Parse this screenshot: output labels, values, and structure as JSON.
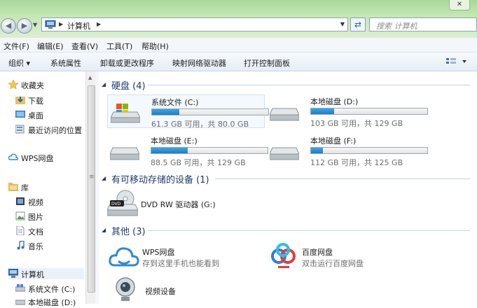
{
  "window": {
    "controls_label": "✕"
  },
  "address": {
    "breadcrumb": "计算机",
    "search_placeholder": "搜索 计算机"
  },
  "menu": {
    "items": [
      "文件(F)",
      "编辑(E)",
      "查看(V)",
      "工具(T)",
      "帮助(H)"
    ]
  },
  "toolbar": {
    "items": [
      "组织",
      "系统属性",
      "卸载或更改程序",
      "映射网络驱动器",
      "打开控制面板"
    ]
  },
  "nav": {
    "favorites": "收藏夹",
    "downloads": "下载",
    "desktop": "桌面",
    "recent": "最近访问的位置",
    "wps": "WPS网盘",
    "libraries": "库",
    "videos": "视频",
    "pictures": "图片",
    "documents": "文档",
    "music": "音乐",
    "computer": "计算机",
    "drive_c": "系统文件 (C:)",
    "drive_d": "本地磁盘 (D:)"
  },
  "groups": {
    "hard_disks": "硬盘 (4)",
    "removable": "有可移动存储的设备 (1)",
    "other": "其他 (3)"
  },
  "drives": [
    {
      "name": "系统文件 (C:)",
      "size": "61.3 GB 可用，共 80.0 GB",
      "used_fraction": 0.234
    },
    {
      "name": "本地磁盘 (D:)",
      "size": "103 GB 可用，共 129 GB",
      "used_fraction": 0.2
    },
    {
      "name": "本地磁盘 (E:)",
      "size": "88.5 GB 可用，共 129 GB",
      "used_fraction": 0.314
    },
    {
      "name": "本地磁盘 (F:)",
      "size": "112 GB 可用，共 125 GB",
      "used_fraction": 0.104
    }
  ],
  "removable": [
    {
      "name": "DVD RW 驱动器 (G:)"
    }
  ],
  "others": [
    {
      "name": "WPS网盘",
      "desc": "存到这里手机也能看到"
    },
    {
      "name": "百度网盘",
      "desc": "双击运行百度网盘"
    },
    {
      "name": "视频设备",
      "desc": ""
    }
  ],
  "colors": {
    "bar_fill": "#1a7fc8",
    "group_title": "#1e3c6e",
    "titlebar": "#a9d89a"
  }
}
